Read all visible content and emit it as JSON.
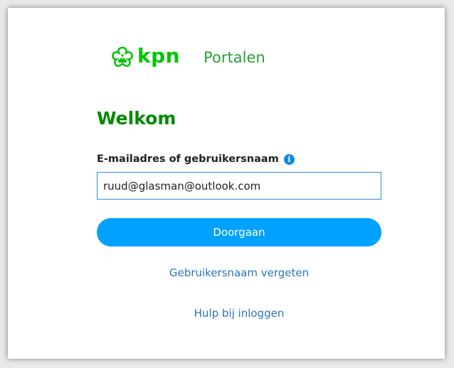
{
  "header": {
    "brand": "kpn",
    "portal_label": "Portalen"
  },
  "login": {
    "heading": "Welkom",
    "field_label": "E-mailadres of gebruikersnaam",
    "info_glyph": "i",
    "input_value": "ruud@glasman@outlook.com",
    "submit_label": "Doorgaan",
    "forgot_link": "Gebruikersnaam vergeten",
    "help_link": "Hulp bij inloggen"
  },
  "colors": {
    "brand_green": "#00c300",
    "heading_green": "#008a00",
    "button_blue": "#00a1ff",
    "link_blue": "#2b74b8",
    "info_blue": "#0b8be6"
  },
  "icons": {
    "logo": "kpn-crown-icon",
    "info": "info-icon"
  }
}
